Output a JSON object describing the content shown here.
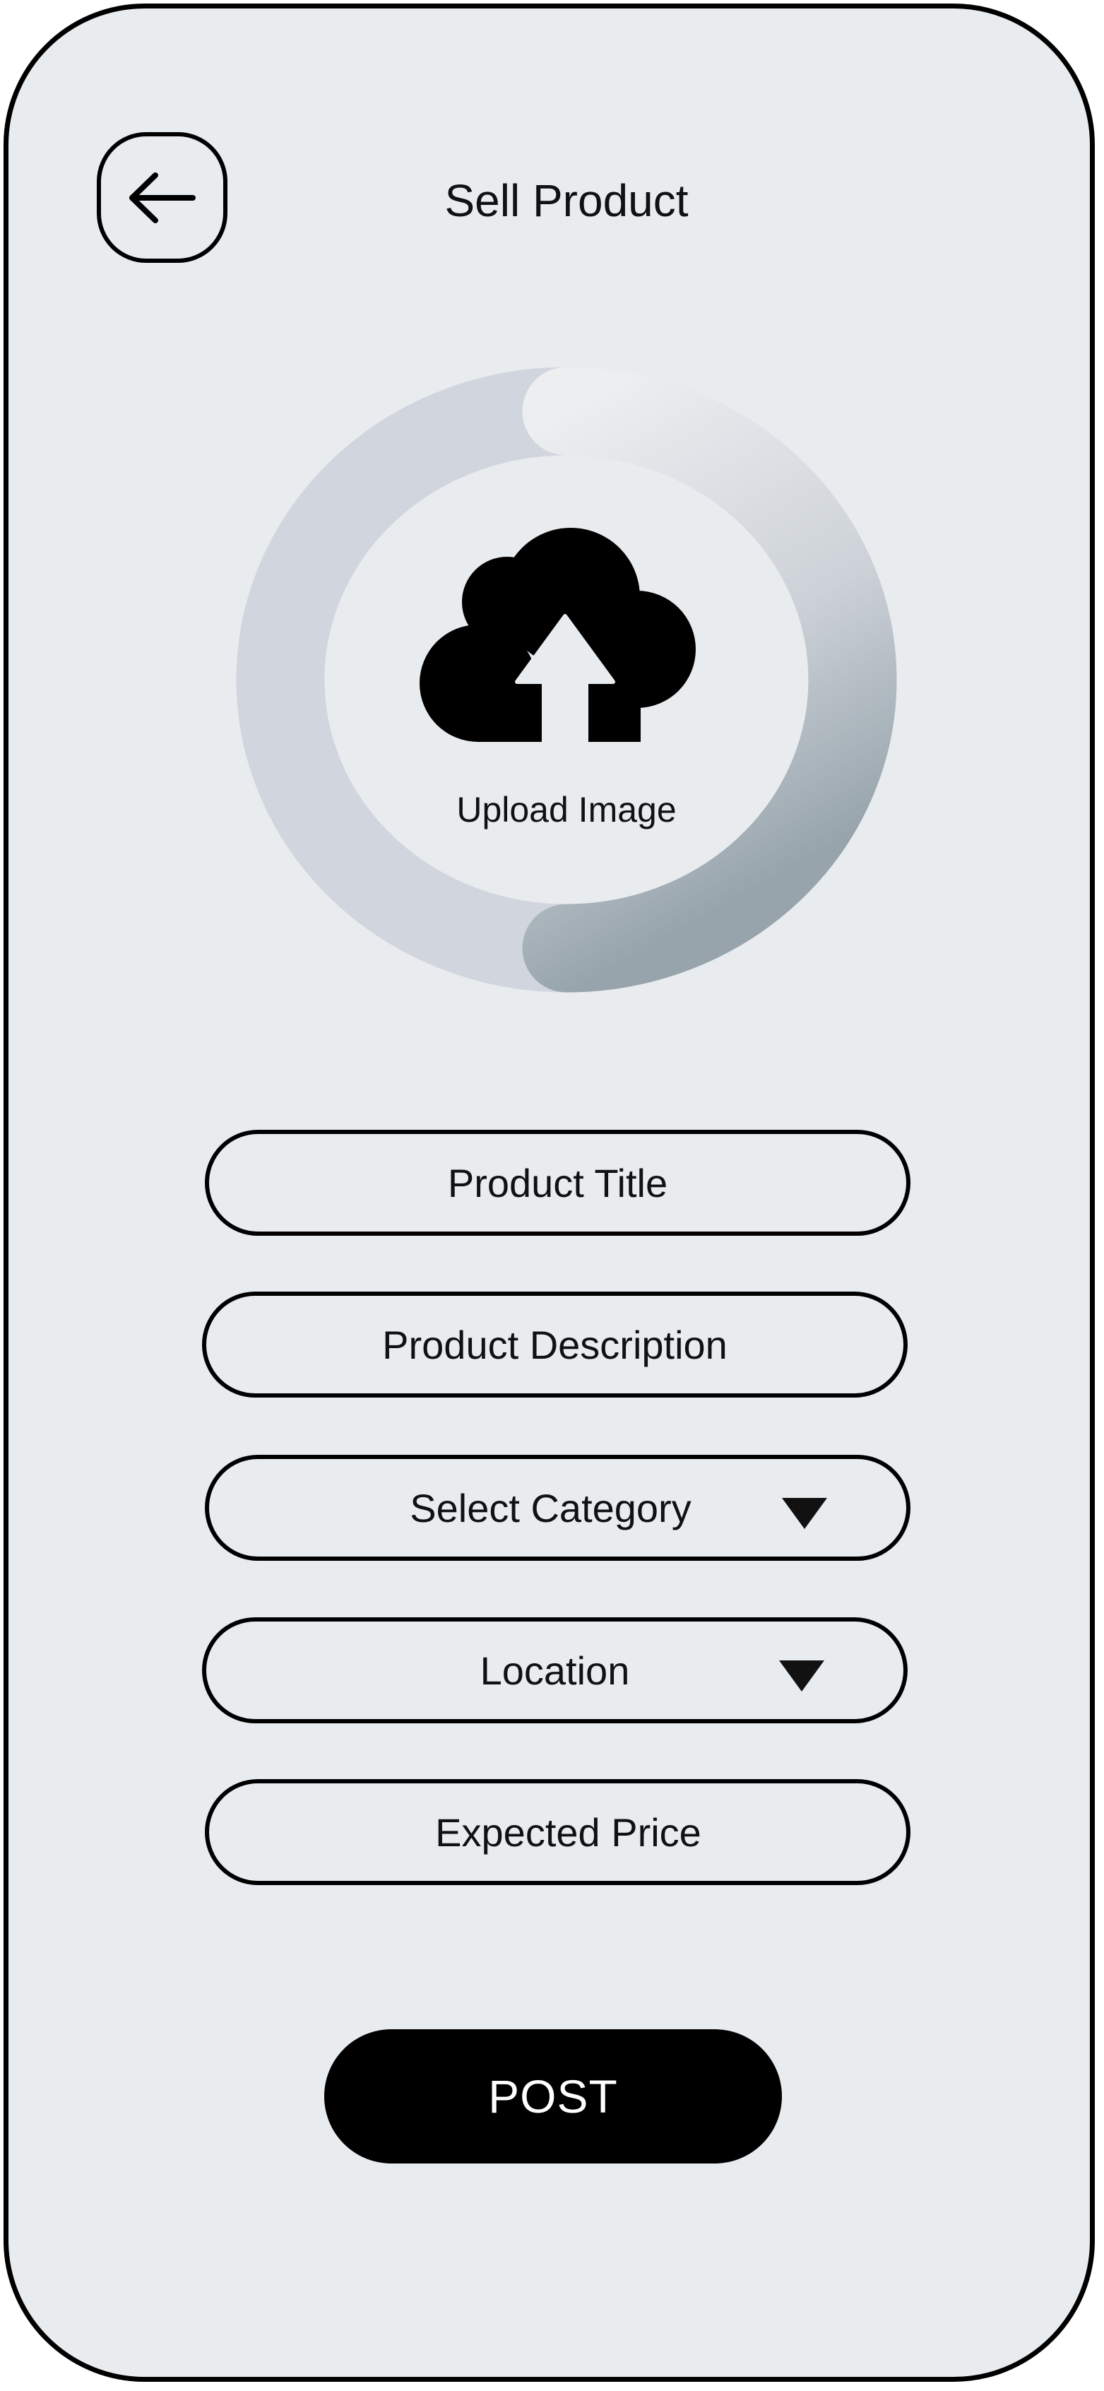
{
  "header": {
    "title": "Sell Product",
    "back_icon": "arrow-left-icon"
  },
  "upload": {
    "label": "Upload Image",
    "icon": "cloud-upload-icon"
  },
  "form": {
    "product_title": "Product Title",
    "product_description": "Product Description",
    "select_category": "Select Category",
    "location": "Location",
    "expected_price": "Expected Price",
    "dropdown_icon": "triangle-down-icon"
  },
  "actions": {
    "post_label": "POST"
  },
  "colors": {
    "background": "#e9ecef",
    "ring_track": "#d1d6de",
    "ring_progress_start": "#eceef0",
    "ring_progress_end": "#97a4ac",
    "button": "#000000",
    "button_text": "#ffffff"
  }
}
